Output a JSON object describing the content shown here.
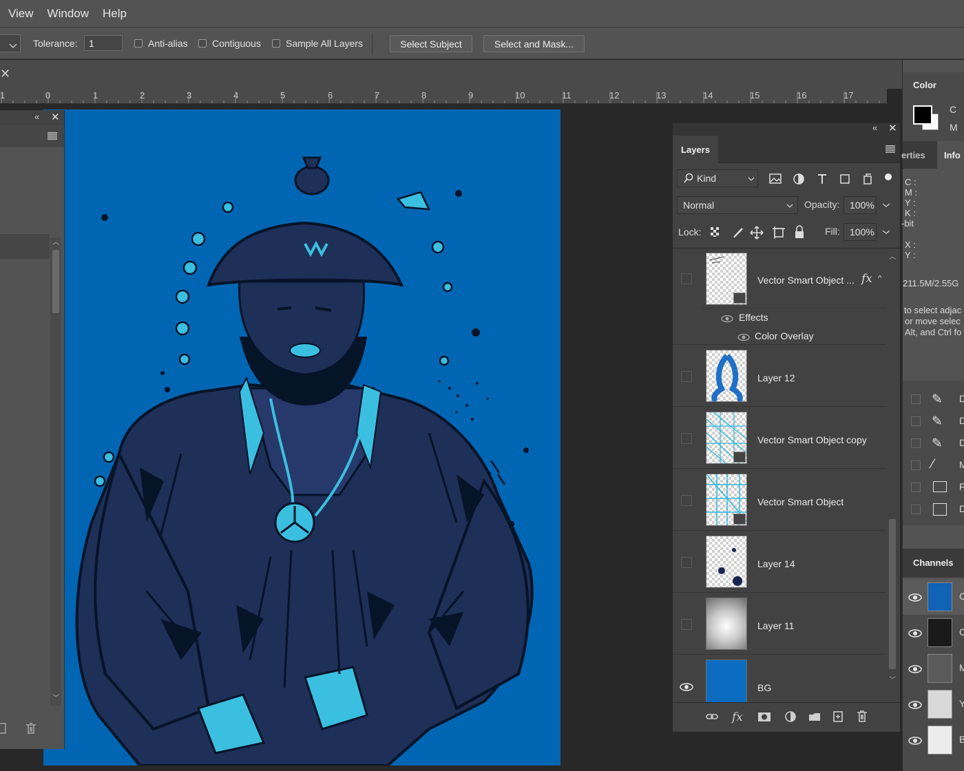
{
  "menubar": {
    "items": [
      "View",
      "Window",
      "Help"
    ]
  },
  "options": {
    "tolerance_label": "Tolerance:",
    "tolerance_value": "1",
    "anti_alias": "Anti-alias",
    "contiguous": "Contiguous",
    "sample_all": "Sample All Layers",
    "select_subject": "Select Subject",
    "select_mask": "Select and Mask..."
  },
  "ruler": {
    "numbers": [
      "1",
      "0",
      "1",
      "2",
      "3",
      "4",
      "5",
      "6",
      "7",
      "8",
      "9",
      "10",
      "11",
      "12",
      "13",
      "14",
      "15",
      "16",
      "17"
    ]
  },
  "layers_panel": {
    "tab": "Layers",
    "kind_label": "Kind",
    "blend_mode": "Normal",
    "opacity_label": "Opacity:",
    "opacity_value": "100%",
    "lock_label": "Lock:",
    "fill_label": "Fill:",
    "fill_value": "100%",
    "effects_label": "Effects",
    "color_overlay_label": "Color Overlay",
    "fx_glyph": "fx",
    "layers": [
      {
        "name": "Vector Smart Object ...",
        "visible": false
      },
      {
        "name": "Layer 12",
        "visible": false
      },
      {
        "name": "Vector Smart Object copy",
        "visible": false
      },
      {
        "name": "Vector Smart Object",
        "visible": false
      },
      {
        "name": "Layer 14",
        "visible": false
      },
      {
        "name": "Layer 11",
        "visible": false
      },
      {
        "name": "BG",
        "visible": true
      }
    ]
  },
  "right_strip": {
    "color_tab": "Color",
    "color_c": "C",
    "color_m": "M",
    "properties_tab": "erties",
    "info_tab": "Info",
    "info_lines": [
      "C :",
      "M :",
      "Y :",
      "K :",
      "-bit"
    ],
    "xy_lines": [
      "X :",
      "Y :"
    ],
    "doc_size": "211.5M/2.55G",
    "hint_lines": [
      "to select adjac",
      "or move selec",
      "Alt, and Ctrl fo"
    ],
    "action_letters": [
      "D",
      "D",
      "D",
      "M",
      "F",
      "D"
    ],
    "channels_tab": "Channels",
    "channel_letters": [
      "C",
      "C",
      "M",
      "Y",
      "B"
    ]
  },
  "colors": {
    "artboard": "#0066b3",
    "figure_dark": "#1e2f58",
    "accent_cyan": "#3bbfe0"
  }
}
